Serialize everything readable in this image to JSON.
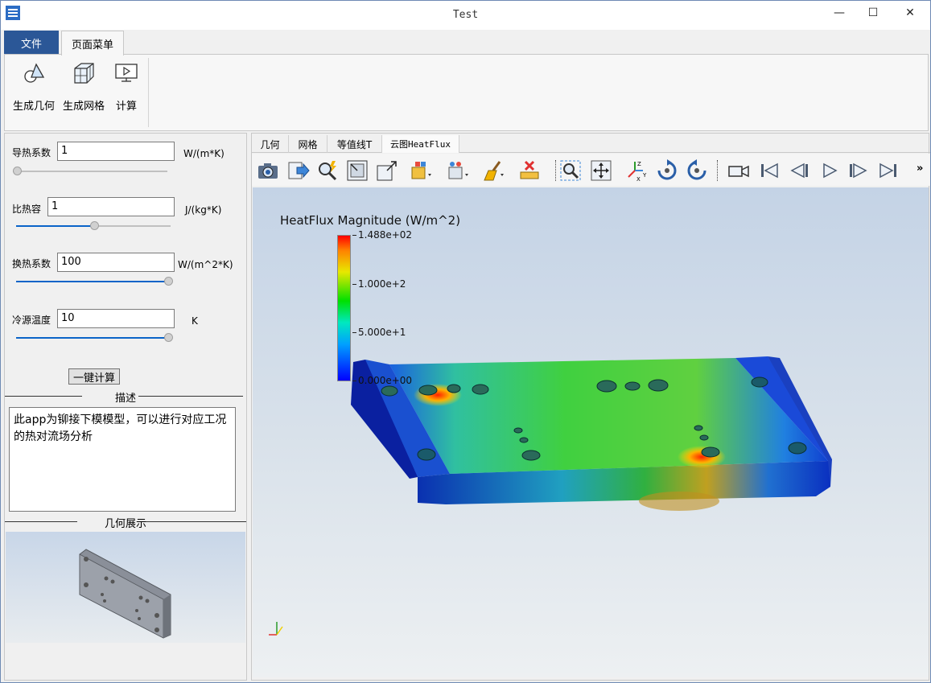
{
  "window": {
    "title": "Test",
    "minimize": "—",
    "maximize": "☐",
    "close": "✕"
  },
  "ribbon": {
    "tabs": {
      "file": "文件",
      "page_menu": "页面菜单"
    },
    "buttons": {
      "geometry": "生成几何",
      "mesh": "生成网格",
      "compute": "计算"
    }
  },
  "params": {
    "thermal_conductivity": {
      "label": "导热系数",
      "value": "1",
      "unit": "W/(m*K)",
      "slider": 0.0
    },
    "specific_heat": {
      "label": "比热容",
      "value": "1",
      "unit": "J/(kg*K)",
      "slider": 0.5
    },
    "heat_transfer_coeff": {
      "label": "换热系数",
      "value": "100",
      "unit": "W/(m^2*K)",
      "slider": 1.0
    },
    "cold_source_temp": {
      "label": "冷源温度",
      "value": "10",
      "unit": "K",
      "slider": 1.0
    }
  },
  "calc_button": "一键计算",
  "description": {
    "title": "描述",
    "text": "此app为铆接下模模型，可以进行对应工况的热对流场分析"
  },
  "geometry_preview": {
    "title": "几何展示"
  },
  "view_tabs": [
    "几何",
    "网格",
    "等值线T",
    "云图HeatFlux"
  ],
  "toolbar": {
    "icons": [
      "camera-icon",
      "export-icon",
      "pick-icon",
      "zoom-box-icon",
      "zoom-out-box-icon",
      "select-cells-icon",
      "select-points-icon",
      "clear-brush-icon",
      "ruler-delete-icon",
      "zoom-to-box-icon",
      "reset-camera-icon",
      "axes-orient-icon",
      "rotate-cw-icon",
      "rotate-ccw-icon",
      "video-camera-icon",
      "first-frame-icon",
      "prev-frame-icon",
      "play-icon",
      "next-frame-icon",
      "last-frame-icon"
    ],
    "overflow": "»"
  },
  "legend": {
    "title": "HeatFlux Magnitude (W/m^2)",
    "ticks": [
      "1.488e+02",
      "1.000e+2",
      "5.000e+1",
      "0.000e+00"
    ],
    "colors": [
      "#ff0000",
      "#e8e800",
      "#00e000",
      "#00a0ff",
      "#0000ff"
    ]
  }
}
